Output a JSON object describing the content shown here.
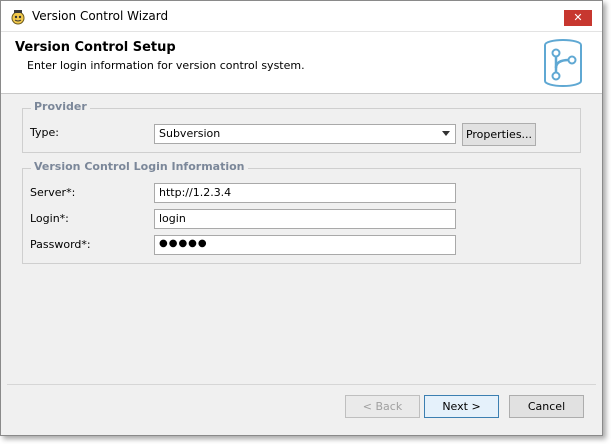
{
  "window": {
    "title": "Version Control Wizard",
    "close_glyph": "✕",
    "icon": "wizard-app-icon"
  },
  "header": {
    "title": "Version Control Setup",
    "subtitle": "Enter login information for version control system.",
    "logo_icon": "version-control-database-icon"
  },
  "provider": {
    "group_title": "Provider",
    "type_label": "Type:",
    "type_value": "Subversion",
    "properties_label": "Properties..."
  },
  "login": {
    "group_title": "Version Control Login Information",
    "server_label": "Server*:",
    "server_value": "http://1.2.3.4",
    "login_label": "Login*:",
    "login_value": "login",
    "password_label": "Password*:",
    "password_value": "●●●●●"
  },
  "buttons": {
    "back": "< Back",
    "next": "Next >",
    "cancel": "Cancel"
  },
  "colors": {
    "close": "#c7372f",
    "group_title": "#7b8799",
    "logo": "#5fa8d3"
  }
}
